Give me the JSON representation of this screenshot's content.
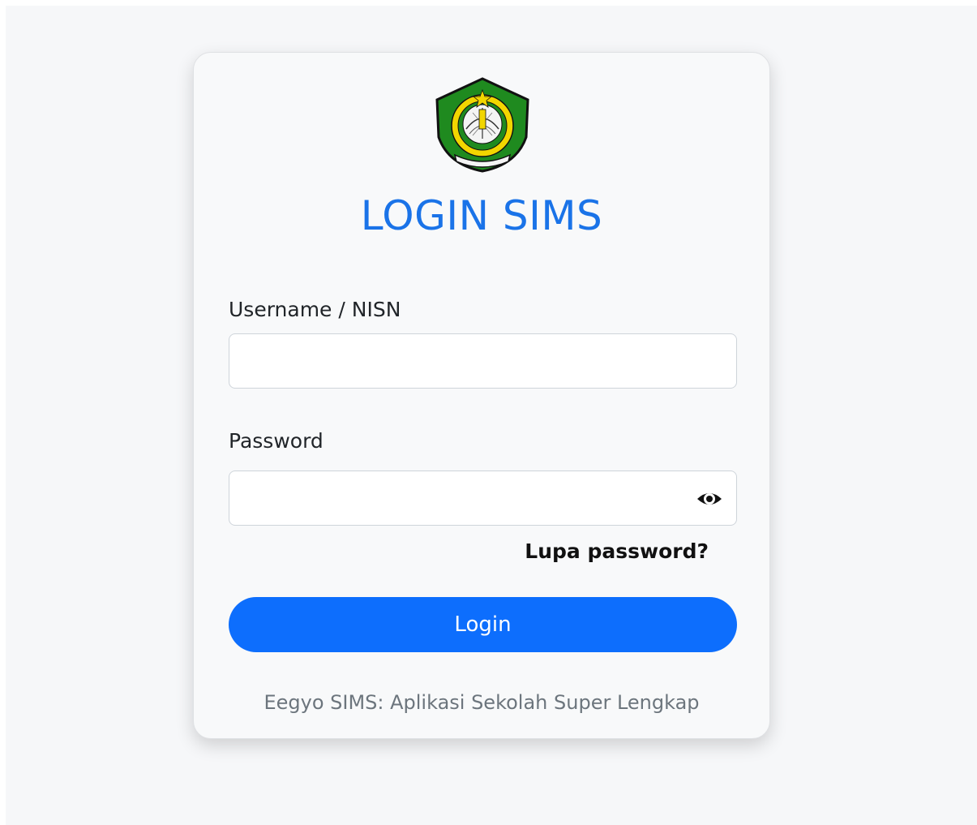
{
  "login": {
    "title": "LOGIN SIMS",
    "username_label": "Username / NISN",
    "username_value": "",
    "password_label": "Password",
    "password_value": "",
    "forgot_link": "Lupa password?",
    "submit_label": "Login",
    "footer_text": "Eegyo SIMS: Aplikasi Sekolah Super Lengkap"
  },
  "icons": {
    "logo": "school-crest-logo",
    "toggle_password": "eye-icon"
  },
  "colors": {
    "title": "#1a73e8",
    "primary_button": "#0d6efd",
    "logo_green": "#1f8a1f",
    "logo_yellow": "#f2d600",
    "footer_text": "#6c757d"
  }
}
